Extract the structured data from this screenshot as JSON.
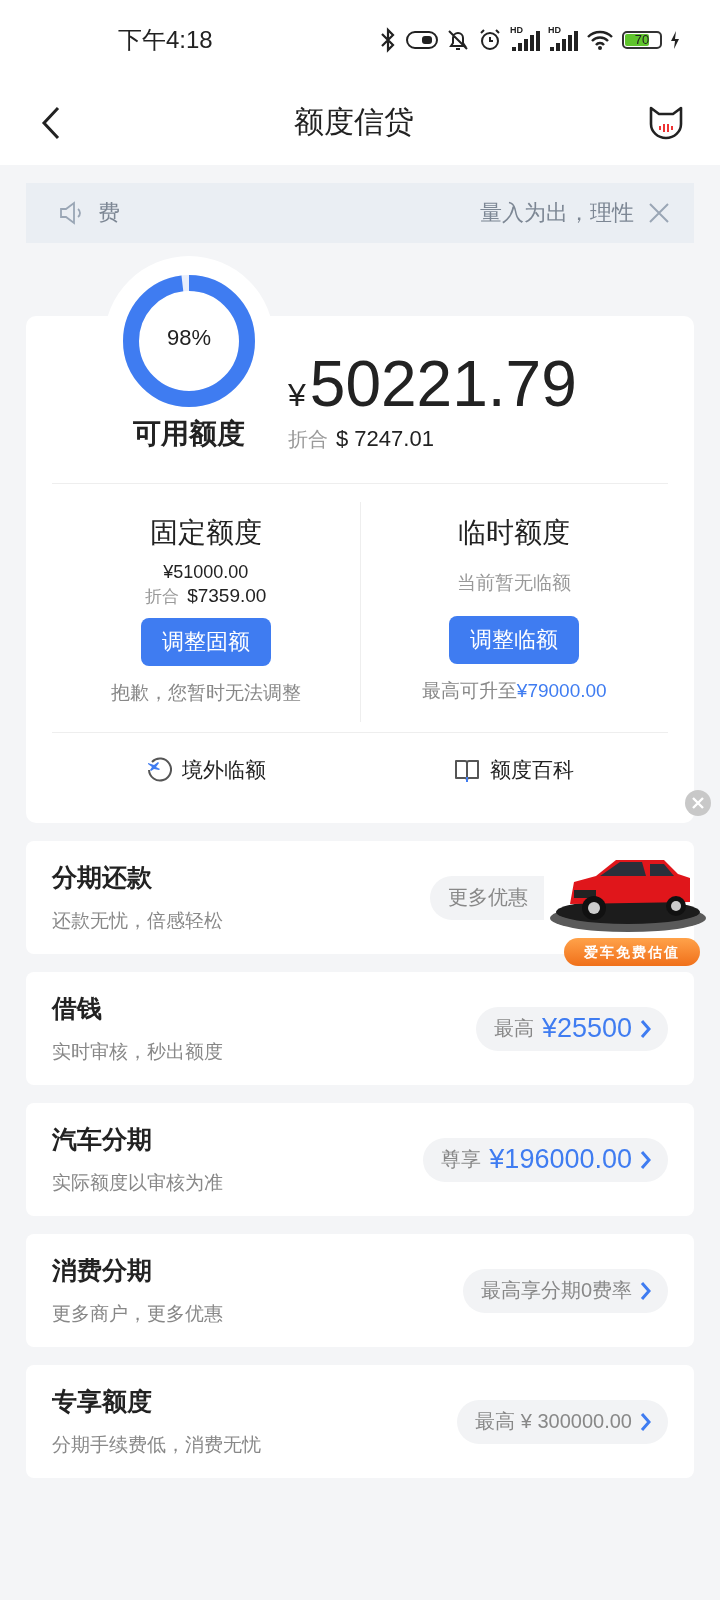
{
  "status_bar": {
    "time": "下午4:18",
    "signal_labels": [
      "HD",
      "HD"
    ],
    "battery": "70"
  },
  "nav": {
    "title": "额度信贷"
  },
  "notice": {
    "left_text": "费",
    "right_text": "量入为出，理性"
  },
  "summary": {
    "level": 0.98,
    "percent": "98%",
    "label": "可用额度",
    "currency": "¥",
    "amount": "50221.79",
    "converted_label": "折合",
    "converted_value": "$ 7247.01"
  },
  "columns": [
    {
      "title": "固定额度",
      "amount": "¥51000.00",
      "converted_label": "折合",
      "converted_value": "$7359.00",
      "button": "调整固额",
      "note": "抱歉，您暂时无法调整"
    },
    {
      "title": "临时额度",
      "hint": "当前暂无临额",
      "button": "调整临额",
      "note": "最高可升至",
      "note_value": "¥79000.00"
    }
  ],
  "links": [
    {
      "kind": "plane",
      "label": "境外临额"
    },
    {
      "kind": "book",
      "label": "额度百科"
    }
  ],
  "ad": {
    "label": "爱车免费估值"
  },
  "products": [
    {
      "title": "分期还款",
      "subtitle": "还款无忧，倍感轻松",
      "pill_label": "更多优惠",
      "chevron": false
    },
    {
      "title": "借钱",
      "subtitle": "实时审核，秒出额度",
      "pill_label": "最高",
      "pill_value": "¥25500",
      "chevron": true
    },
    {
      "title": "汽车分期",
      "subtitle": "实际额度以审核为准",
      "pill_label": "尊享",
      "pill_value": "¥196000.00",
      "chevron": true
    },
    {
      "title": "消费分期",
      "subtitle": "更多商户，更多优惠",
      "pill_label": "最高享分期0费率",
      "chevron": true
    },
    {
      "title": "专享额度",
      "subtitle": "分期手续费低，消费无忧",
      "pill_label": "最高 ¥ 300000.00",
      "chevron": true
    }
  ]
}
